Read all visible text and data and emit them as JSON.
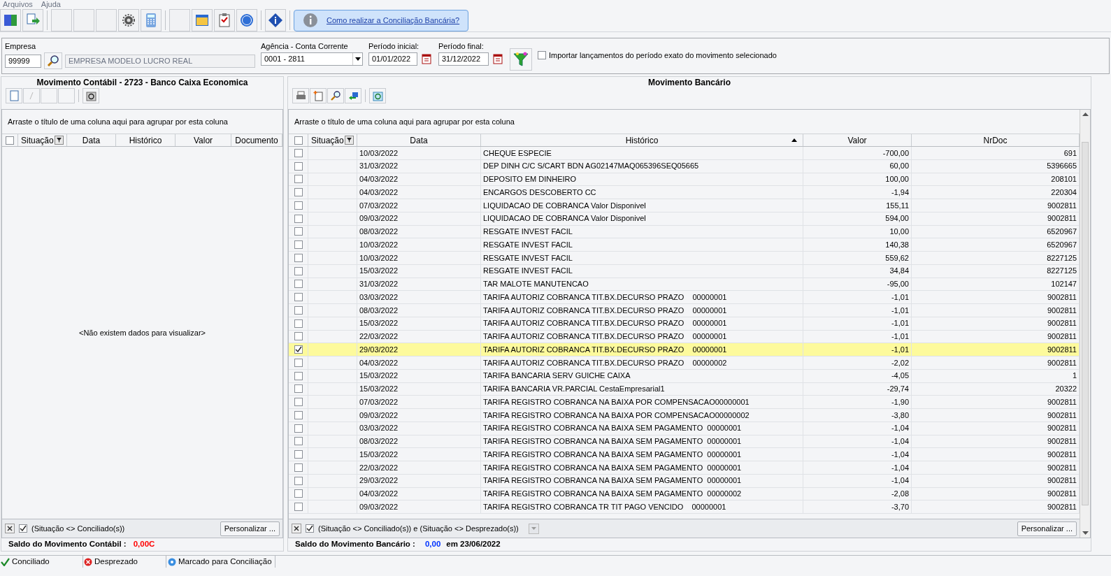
{
  "menu": [
    "Arquivos",
    "Ajuda"
  ],
  "help_link": "Como realizar a Conciliação Bancária?",
  "filters": {
    "empresa_label": "Empresa",
    "empresa_code": "99999",
    "empresa_name": "EMPRESA MODELO LUCRO REAL",
    "conta_label": "Agência - Conta Corrente",
    "conta_value": "0001 - 2811",
    "inicio_label": "Período inicial:",
    "inicio_value": "01/01/2022",
    "fim_label": "Período final:",
    "fim_value": "31/12/2022",
    "importar_label": "Importar lançamentos do período exato do movimento selecionado",
    "importar_checked": false
  },
  "left_panel": {
    "title": "Movimento Contábil - 2723 - Banco Caixa Economica",
    "group_hint": "Arraste o título de uma coluna aqui para agrupar por esta coluna",
    "columns": [
      "Situação",
      "Data",
      "Histórico",
      "Valor",
      "Documento"
    ],
    "select_all_checked": false,
    "empty_text": "<Não existem dados para visualizar>",
    "filter_checked": true,
    "filter_text": "(Situação <> Conciliado(s))",
    "customize": "Personalizar ...",
    "saldo_label": "Saldo do Movimento Contábil :",
    "saldo_value": "0,00C"
  },
  "right_panel": {
    "title": "Movimento Bancário",
    "group_hint": "Arraste o título de uma coluna aqui para agrupar por esta coluna",
    "columns": [
      "Situação",
      "Data",
      "Histórico",
      "Valor",
      "NrDoc"
    ],
    "select_all_checked": false,
    "rows": [
      {
        "selected": false,
        "data": "10/03/2022",
        "historico": "CHEQUE ESPECIE",
        "valor": "-700,00",
        "nrdoc": "691"
      },
      {
        "selected": false,
        "data": "31/03/2022",
        "historico": "DEP DINH C/C S/CART BDN AG02147MAQ065396SEQ05665",
        "valor": "60,00",
        "nrdoc": "5396665"
      },
      {
        "selected": false,
        "data": "04/03/2022",
        "historico": "DEPOSITO EM DINHEIRO",
        "valor": "100,00",
        "nrdoc": "208101"
      },
      {
        "selected": false,
        "data": "04/03/2022",
        "historico": "ENCARGOS DESCOBERTO CC",
        "valor": "-1,94",
        "nrdoc": "220304"
      },
      {
        "selected": false,
        "data": "07/03/2022",
        "historico": "LIQUIDACAO DE COBRANCA Valor Disponivel",
        "valor": "155,11",
        "nrdoc": "9002811"
      },
      {
        "selected": false,
        "data": "09/03/2022",
        "historico": "LIQUIDACAO DE COBRANCA Valor Disponivel",
        "valor": "594,00",
        "nrdoc": "9002811"
      },
      {
        "selected": false,
        "data": "08/03/2022",
        "historico": "RESGATE INVEST FACIL",
        "valor": "10,00",
        "nrdoc": "6520967"
      },
      {
        "selected": false,
        "data": "10/03/2022",
        "historico": "RESGATE INVEST FACIL",
        "valor": "140,38",
        "nrdoc": "6520967"
      },
      {
        "selected": false,
        "data": "10/03/2022",
        "historico": "RESGATE INVEST FACIL",
        "valor": "559,62",
        "nrdoc": "8227125"
      },
      {
        "selected": false,
        "data": "15/03/2022",
        "historico": "RESGATE INVEST FACIL",
        "valor": "34,84",
        "nrdoc": "8227125"
      },
      {
        "selected": false,
        "data": "31/03/2022",
        "historico": "TAR MALOTE MANUTENCAO",
        "valor": "-95,00",
        "nrdoc": "102147"
      },
      {
        "selected": false,
        "data": "03/03/2022",
        "historico": "TARIFA AUTORIZ COBRANCA TIT.BX.DECURSO PRAZO    00000001",
        "valor": "-1,01",
        "nrdoc": "9002811"
      },
      {
        "selected": false,
        "data": "08/03/2022",
        "historico": "TARIFA AUTORIZ COBRANCA TIT.BX.DECURSO PRAZO    00000001",
        "valor": "-1,01",
        "nrdoc": "9002811"
      },
      {
        "selected": false,
        "data": "15/03/2022",
        "historico": "TARIFA AUTORIZ COBRANCA TIT.BX.DECURSO PRAZO    00000001",
        "valor": "-1,01",
        "nrdoc": "9002811"
      },
      {
        "selected": false,
        "data": "22/03/2022",
        "historico": "TARIFA AUTORIZ COBRANCA TIT.BX.DECURSO PRAZO    00000001",
        "valor": "-1,01",
        "nrdoc": "9002811"
      },
      {
        "selected": true,
        "data": "29/03/2022",
        "historico": "TARIFA AUTORIZ COBRANCA TIT.BX.DECURSO PRAZO    00000001",
        "valor": "-1,01",
        "nrdoc": "9002811"
      },
      {
        "selected": false,
        "data": "04/03/2022",
        "historico": "TARIFA AUTORIZ COBRANCA TIT.BX.DECURSO PRAZO    00000002",
        "valor": "-2,02",
        "nrdoc": "9002811"
      },
      {
        "selected": false,
        "data": "15/03/2022",
        "historico": "TARIFA BANCARIA SERV GUICHE CAIXA",
        "valor": "-4,05",
        "nrdoc": "1"
      },
      {
        "selected": false,
        "data": "15/03/2022",
        "historico": "TARIFA BANCARIA VR.PARCIAL CestaEmpresarial1",
        "valor": "-29,74",
        "nrdoc": "20322"
      },
      {
        "selected": false,
        "data": "07/03/2022",
        "historico": "TARIFA REGISTRO COBRANCA NA BAIXA POR COMPENSACAO00000001",
        "valor": "-1,90",
        "nrdoc": "9002811"
      },
      {
        "selected": false,
        "data": "09/03/2022",
        "historico": "TARIFA REGISTRO COBRANCA NA BAIXA POR COMPENSACAO00000002",
        "valor": "-3,80",
        "nrdoc": "9002811"
      },
      {
        "selected": false,
        "data": "03/03/2022",
        "historico": "TARIFA REGISTRO COBRANCA NA BAIXA SEM PAGAMENTO  00000001",
        "valor": "-1,04",
        "nrdoc": "9002811"
      },
      {
        "selected": false,
        "data": "08/03/2022",
        "historico": "TARIFA REGISTRO COBRANCA NA BAIXA SEM PAGAMENTO  00000001",
        "valor": "-1,04",
        "nrdoc": "9002811"
      },
      {
        "selected": false,
        "data": "15/03/2022",
        "historico": "TARIFA REGISTRO COBRANCA NA BAIXA SEM PAGAMENTO  00000001",
        "valor": "-1,04",
        "nrdoc": "9002811"
      },
      {
        "selected": false,
        "data": "22/03/2022",
        "historico": "TARIFA REGISTRO COBRANCA NA BAIXA SEM PAGAMENTO  00000001",
        "valor": "-1,04",
        "nrdoc": "9002811"
      },
      {
        "selected": false,
        "data": "29/03/2022",
        "historico": "TARIFA REGISTRO COBRANCA NA BAIXA SEM PAGAMENTO  00000001",
        "valor": "-1,04",
        "nrdoc": "9002811"
      },
      {
        "selected": false,
        "data": "04/03/2022",
        "historico": "TARIFA REGISTRO COBRANCA NA BAIXA SEM PAGAMENTO  00000002",
        "valor": "-2,08",
        "nrdoc": "9002811"
      },
      {
        "selected": false,
        "data": "09/03/2022",
        "historico": "TARIFA REGISTRO COBRANCA TR TIT PAGO VENCIDO    00000001",
        "valor": "-3,70",
        "nrdoc": "9002811"
      }
    ],
    "filter_checked": true,
    "filter_text": "(Situação <> Conciliado(s)) e (Situação <> Desprezado(s))",
    "customize": "Personalizar ...",
    "saldo_label": "Saldo do Movimento Bancário :",
    "saldo_value": "0,00",
    "saldo_suffix": "em 23/06/2022"
  },
  "legend": [
    {
      "kind": "check",
      "label": "Conciliado"
    },
    {
      "kind": "x",
      "label": "Desprezado"
    },
    {
      "kind": "dot",
      "label": "Marcado para Conciliação"
    }
  ]
}
